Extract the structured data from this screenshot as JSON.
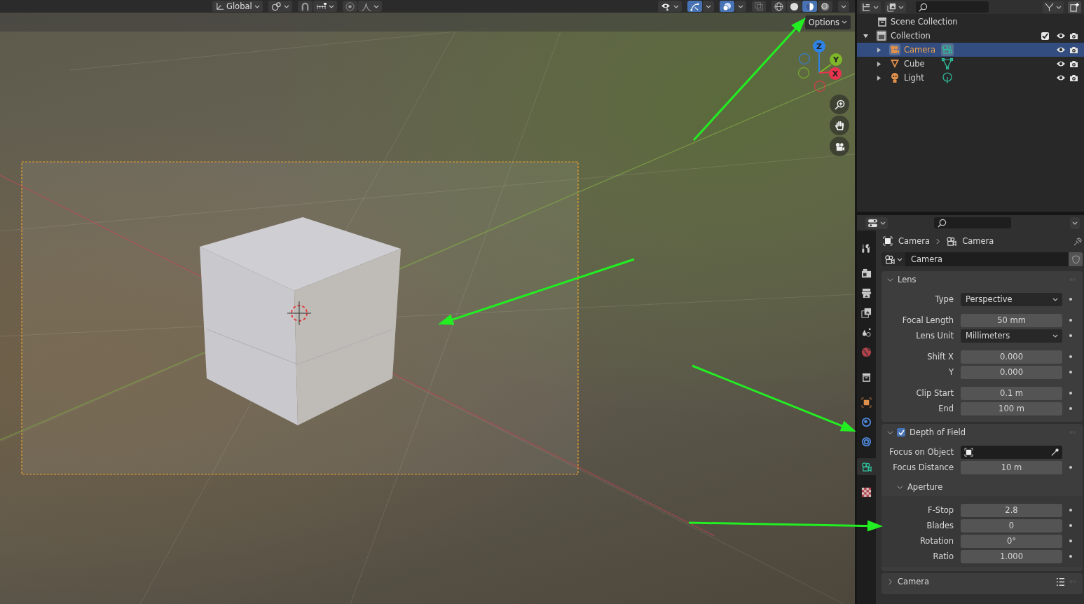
{
  "viewport_header": {
    "orientation": "Global",
    "snap": false,
    "proportional": false,
    "gizmos": true,
    "overlays": true,
    "xray": false,
    "shading_modes": [
      {
        "kind": "wireframe",
        "selected": false
      },
      {
        "kind": "solid",
        "selected": false
      },
      {
        "kind": "material",
        "selected": true
      },
      {
        "kind": "rendered",
        "selected": false
      }
    ]
  },
  "viewport": {
    "options_button": "Options",
    "gizmo_axes": [
      {
        "label": "Z",
        "color": "#2f82e6"
      },
      {
        "label": "Y",
        "color": "#7fb62a"
      },
      {
        "label": "X",
        "color": "#e8344e"
      }
    ]
  },
  "outliner": {
    "scene_collection": "Scene Collection",
    "collection": {
      "label": "Collection",
      "expanded": true,
      "checked": true,
      "visible": true,
      "renderable": true,
      "children": [
        {
          "label": "Camera",
          "kind": "camera",
          "selected": true,
          "expanded": false,
          "visible": true,
          "renderable": true
        },
        {
          "label": "Cube",
          "kind": "mesh",
          "selected": false,
          "expanded": false,
          "visible": true,
          "renderable": true
        },
        {
          "label": "Light",
          "kind": "light",
          "selected": false,
          "expanded": false,
          "visible": true,
          "renderable": true
        }
      ]
    }
  },
  "properties": {
    "breadcrumb": [
      "Camera",
      "Camera"
    ],
    "datablock": "Camera",
    "tabs": [
      {
        "kind": "tool",
        "selected": false
      },
      {
        "kind": "render",
        "selected": false
      },
      {
        "kind": "output",
        "selected": false
      },
      {
        "kind": "view_layer",
        "selected": false
      },
      {
        "kind": "scene",
        "selected": false
      },
      {
        "kind": "world",
        "selected": false
      },
      {
        "kind": "collection",
        "selected": false
      },
      {
        "kind": "object",
        "selected": false
      },
      {
        "kind": "physics",
        "selected": false
      },
      {
        "kind": "constraints",
        "selected": false
      },
      {
        "kind": "camera_data",
        "selected": true
      },
      {
        "kind": "texture",
        "selected": false
      }
    ],
    "panels": [
      {
        "title": "Lens",
        "expanded": true,
        "groups": [
          [
            {
              "label": "Type",
              "kind": "select",
              "value": "Perspective"
            }
          ],
          [
            {
              "label": "Focal Length",
              "kind": "number",
              "value": "50 mm"
            },
            {
              "label": "Lens Unit",
              "kind": "select",
              "value": "Millimeters"
            }
          ],
          [
            {
              "label": "Shift X",
              "kind": "number",
              "value": "0.000"
            },
            {
              "label": "Y",
              "kind": "number",
              "value": "0.000"
            }
          ],
          [
            {
              "label": "Clip Start",
              "kind": "number",
              "value": "0.1 m"
            },
            {
              "label": "End",
              "kind": "number",
              "value": "100 m"
            }
          ]
        ]
      },
      {
        "title": "Depth of Field",
        "expanded": true,
        "checked": true,
        "groups": [
          [
            {
              "label": "Focus on Object",
              "kind": "object"
            },
            {
              "label": "Focus Distance",
              "kind": "number",
              "value": "10 m"
            }
          ]
        ],
        "subpanels": [
          {
            "title": "Aperture",
            "expanded": true,
            "groups": [
              [
                {
                  "label": "F-Stop",
                  "kind": "number",
                  "value": "2.8"
                },
                {
                  "label": "Blades",
                  "kind": "number",
                  "value": "0"
                },
                {
                  "label": "Rotation",
                  "kind": "number",
                  "value": "0°"
                },
                {
                  "label": "Ratio",
                  "kind": "number",
                  "value": "1.000"
                }
              ]
            ]
          }
        ]
      },
      {
        "title": "Camera",
        "expanded": false,
        "presets": true
      }
    ]
  }
}
